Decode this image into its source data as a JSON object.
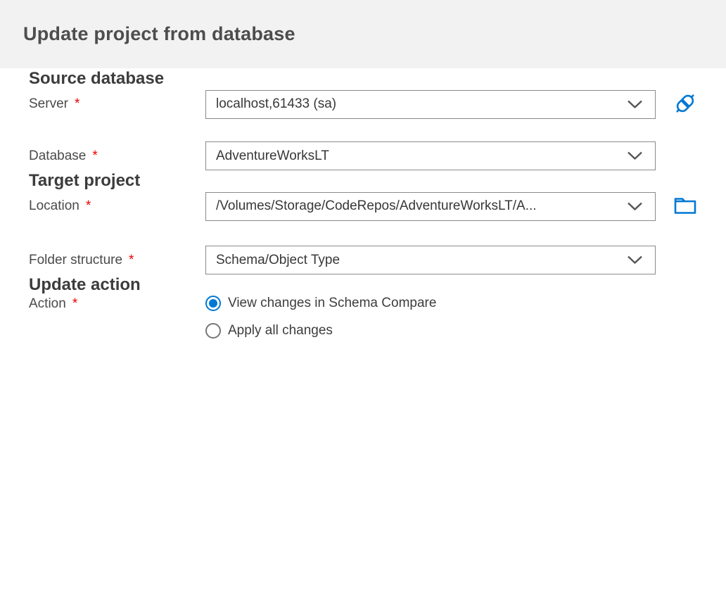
{
  "header": {
    "title": "Update project from database"
  },
  "sections": {
    "source": {
      "title": "Source database",
      "server": {
        "label": "Server",
        "required": "*",
        "value": "localhost,61433 (sa)"
      },
      "database": {
        "label": "Database",
        "required": "*",
        "value": "AdventureWorksLT"
      }
    },
    "target": {
      "title": "Target project",
      "location": {
        "label": "Location",
        "required": "*",
        "value": "/Volumes/Storage/CodeRepos/AdventureWorksLT/A..."
      },
      "folder_structure": {
        "label": "Folder structure",
        "required": "*",
        "value": "Schema/Object Type"
      }
    },
    "update": {
      "title": "Update action",
      "action": {
        "label": "Action",
        "required": "*",
        "options": [
          {
            "label": "View changes in Schema Compare",
            "selected": true
          },
          {
            "label": "Apply all changes",
            "selected": false
          }
        ]
      }
    }
  },
  "icons": {
    "connect": "connect-plug-icon",
    "browse": "folder-icon",
    "dropdown": "chevron-down-icon"
  },
  "colors": {
    "accent": "#0078d4",
    "required": "#eb0000",
    "header_background": "#f2f2f2",
    "field_border": "#8a8a8a"
  }
}
